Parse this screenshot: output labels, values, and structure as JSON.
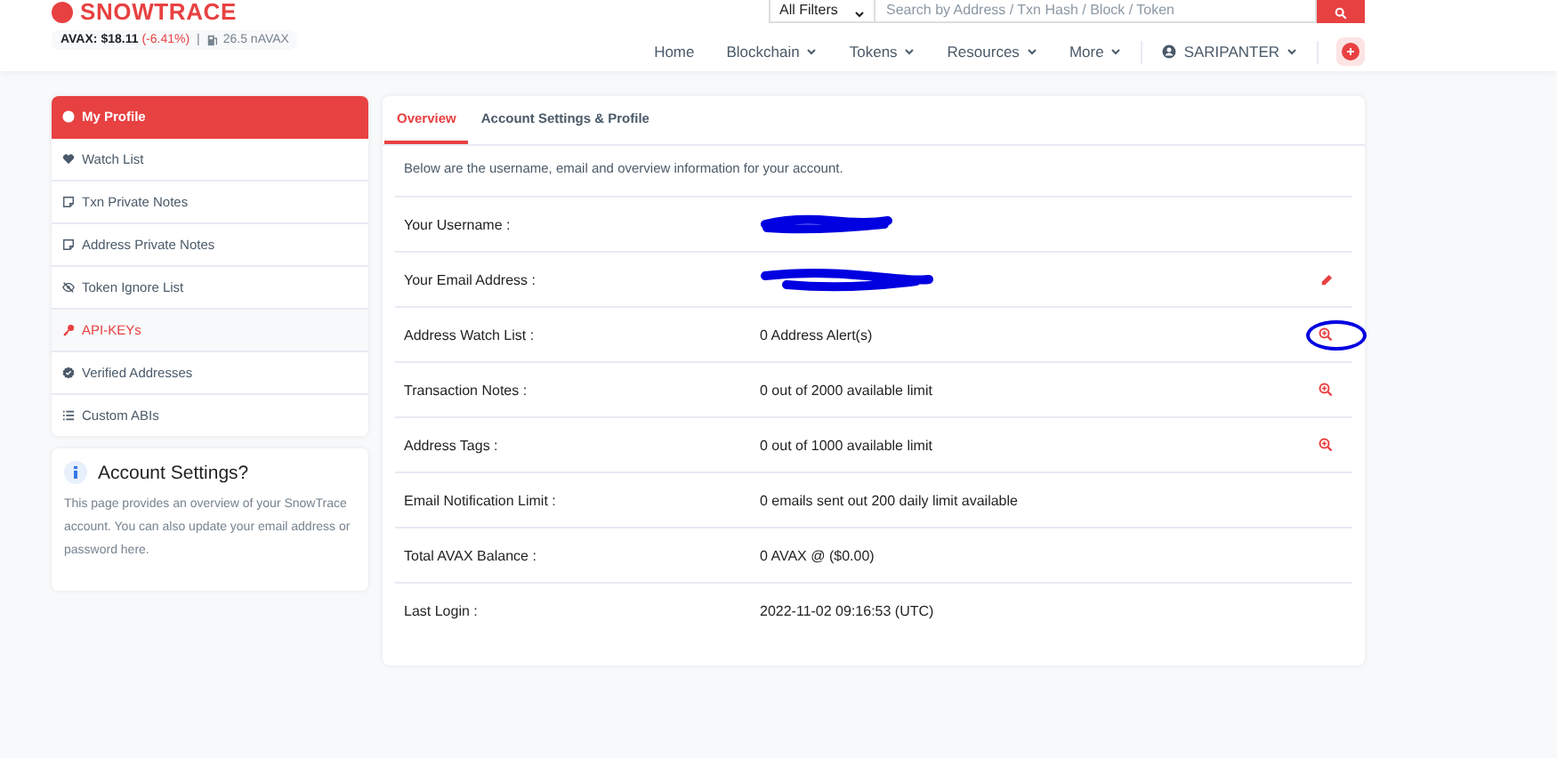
{
  "header": {
    "logo": "SNOWTRACE",
    "price_label": "AVAX:",
    "price": "$18.11",
    "change": "(-6.41%)",
    "separator": "|",
    "gas": "26.5 nAVAX",
    "filter": "All Filters",
    "search_placeholder": "Search by Address / Txn Hash / Block / Token",
    "nav": [
      {
        "label": "Home",
        "dropdown": false
      },
      {
        "label": "Blockchain",
        "dropdown": true
      },
      {
        "label": "Tokens",
        "dropdown": true
      },
      {
        "label": "Resources",
        "dropdown": true
      },
      {
        "label": "More",
        "dropdown": true
      }
    ],
    "user": "SARIPANTER"
  },
  "sidebar": {
    "items": [
      {
        "label": "My Profile",
        "kind": "user",
        "selected": true,
        "hovered": false
      },
      {
        "label": "Watch List",
        "kind": "heart",
        "selected": false,
        "hovered": false
      },
      {
        "label": "Txn Private Notes",
        "kind": "note",
        "selected": false,
        "hovered": false
      },
      {
        "label": "Address Private Notes",
        "kind": "note",
        "selected": false,
        "hovered": false
      },
      {
        "label": "Token Ignore List",
        "kind": "hidden",
        "selected": false,
        "hovered": false
      },
      {
        "label": "API-KEYs",
        "kind": "key",
        "selected": false,
        "hovered": true
      },
      {
        "label": "Verified Addresses",
        "kind": "verified",
        "selected": false,
        "hovered": false
      },
      {
        "label": "Custom ABIs",
        "kind": "list",
        "selected": false,
        "hovered": false
      }
    ]
  },
  "info_card": {
    "title": "Account Settings?",
    "text": "This page provides an overview of your SnowTrace account. You can also update your email address or password here."
  },
  "tabs": [
    {
      "label": "Overview",
      "selected": true
    },
    {
      "label": "Account Settings & Profile",
      "selected": false
    }
  ],
  "intro": "Below are the username, email and overview information for your account.",
  "rows": [
    {
      "label": "Your Username :",
      "redacted": true
    },
    {
      "label": "Your Email Address :",
      "redacted": true,
      "kind": "editable"
    },
    {
      "label": "Address Watch List :",
      "value": "0 Address Alert(s)",
      "kind": "viewable",
      "circled": true
    },
    {
      "label": "Transaction Notes :",
      "value": "0 out of 2000 available limit",
      "kind": "viewable"
    },
    {
      "label": "Address Tags :",
      "value": "0 out of 1000 available limit",
      "kind": "viewable"
    },
    {
      "label": "Email Notification Limit :",
      "value": "0 emails sent out 200 daily limit available"
    },
    {
      "label": "Total AVAX Balance :",
      "value": "0 AVAX @ ($0.00)"
    },
    {
      "label": "Last Login :",
      "value": "2022-11-02 09:16:53 (UTC)"
    }
  ]
}
